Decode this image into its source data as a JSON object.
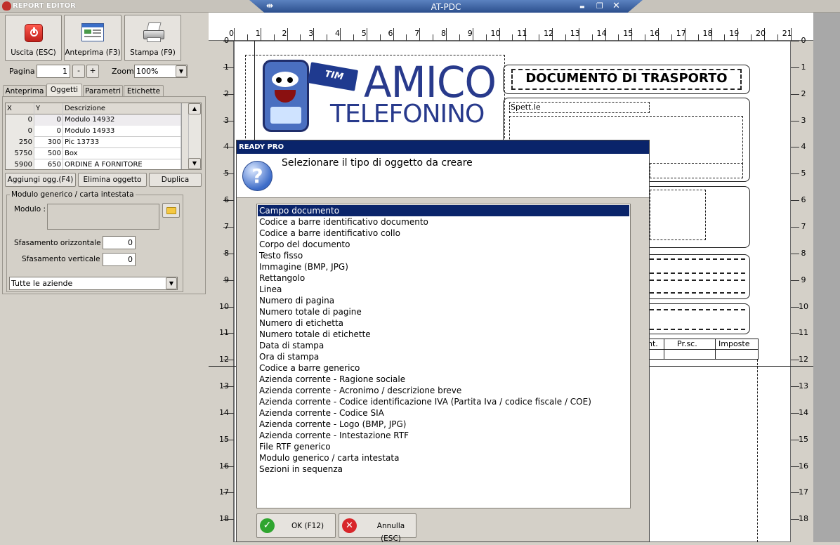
{
  "window": {
    "app_title": "REPORT EDITOR",
    "doc_title": "AT-PDC",
    "pin_glyph": "⇹",
    "min_glyph": "▬",
    "max_glyph": "❐",
    "close_glyph": "✕"
  },
  "toolbar": {
    "exit_label": "Uscita (ESC)",
    "preview_label": "Anteprima (F3)",
    "print_label": "Stampa (F9)"
  },
  "pagination": {
    "page_label": "Pagina",
    "page_value": "1",
    "minus": "-",
    "plus": "+",
    "zoom_label": "Zoom",
    "zoom_value": "100%"
  },
  "tabs": [
    {
      "label": "Anteprima"
    },
    {
      "label": "Oggetti"
    },
    {
      "label": "Parametri"
    },
    {
      "label": "Etichette"
    }
  ],
  "objects_table": {
    "headers": [
      "X",
      "Y",
      "Descrizione"
    ],
    "rows": [
      {
        "x": "0",
        "y": "0",
        "desc": "Modulo 14932"
      },
      {
        "x": "0",
        "y": "0",
        "desc": "Modulo 14933"
      },
      {
        "x": "250",
        "y": "300",
        "desc": "Pic 13733"
      },
      {
        "x": "5750",
        "y": "500",
        "desc": "Box"
      },
      {
        "x": "5900",
        "y": "650",
        "desc": "ORDINE A FORNITORE"
      }
    ]
  },
  "object_actions": {
    "add_label": "Aggiungi ogg.(F4)",
    "delete_label": "Elimina oggetto",
    "duplicate_label": "Duplica"
  },
  "properties": {
    "group_title": "Modulo generico / carta intestata",
    "modulo_label": "Modulo :",
    "h_offset_label": "Sfasamento orizzontale :",
    "h_offset_value": "0",
    "v_offset_label": "Sfasamento verticale :",
    "v_offset_value": "0",
    "company_select": "Tutte le aziende"
  },
  "ruler": {
    "top": [
      "0",
      "1",
      "2",
      "3",
      "4",
      "5",
      "6",
      "7",
      "8",
      "9",
      "10",
      "11",
      "12",
      "13",
      "14",
      "15",
      "16",
      "17",
      "18",
      "19",
      "20",
      "21"
    ],
    "left": [
      "0",
      "1",
      "2",
      "3",
      "4",
      "5",
      "6",
      "7",
      "8",
      "9",
      "10",
      "11",
      "12",
      "13",
      "14",
      "15",
      "16",
      "17",
      "18"
    ]
  },
  "report_page": {
    "logo_line1": "AMICO",
    "logo_line2": "TELEFONINO",
    "logo_badge": "TIM",
    "doc_heading": "DOCUMENTO DI TRASPORTO",
    "recipient_label": "Spett.le",
    "col_headers": [
      "nt.",
      "Pr.sc.",
      "Imposte"
    ]
  },
  "dialog": {
    "title": "READY PRO",
    "prompt": "Selezionare il tipo di oggetto da creare",
    "question_glyph": "?",
    "items": [
      "Campo documento",
      "Codice a barre identificativo documento",
      "Codice a barre identificativo collo",
      "Corpo del documento",
      "Testo fisso",
      "Immagine (BMP, JPG)",
      "Rettangolo",
      "Linea",
      "Numero di pagina",
      "Numero totale di pagine",
      "Numero di etichetta",
      "Numero totale di etichette",
      "Data di stampa",
      "Ora di stampa",
      "Codice a barre generico",
      "Azienda corrente - Ragione sociale",
      "Azienda corrente - Acronimo / descrizione breve",
      "Azienda corrente - Codice identificazione IVA (Partita Iva / codice fiscale / COE)",
      "Azienda corrente - Codice SIA",
      "Azienda corrente - Logo (BMP, JPG)",
      "Azienda corrente - Intestazione RTF",
      "File RTF generico",
      "Modulo generico / carta intestata",
      "Sezioni in sequenza"
    ],
    "selected_index": 0,
    "ok_label": "OK (F12)",
    "cancel_label": "Annulla (ESC)"
  },
  "colors": {
    "selection": "#0a246a",
    "logo_blue": "#283a8c",
    "ok_green": "#2fa52f",
    "cancel_red": "#d8262a"
  }
}
